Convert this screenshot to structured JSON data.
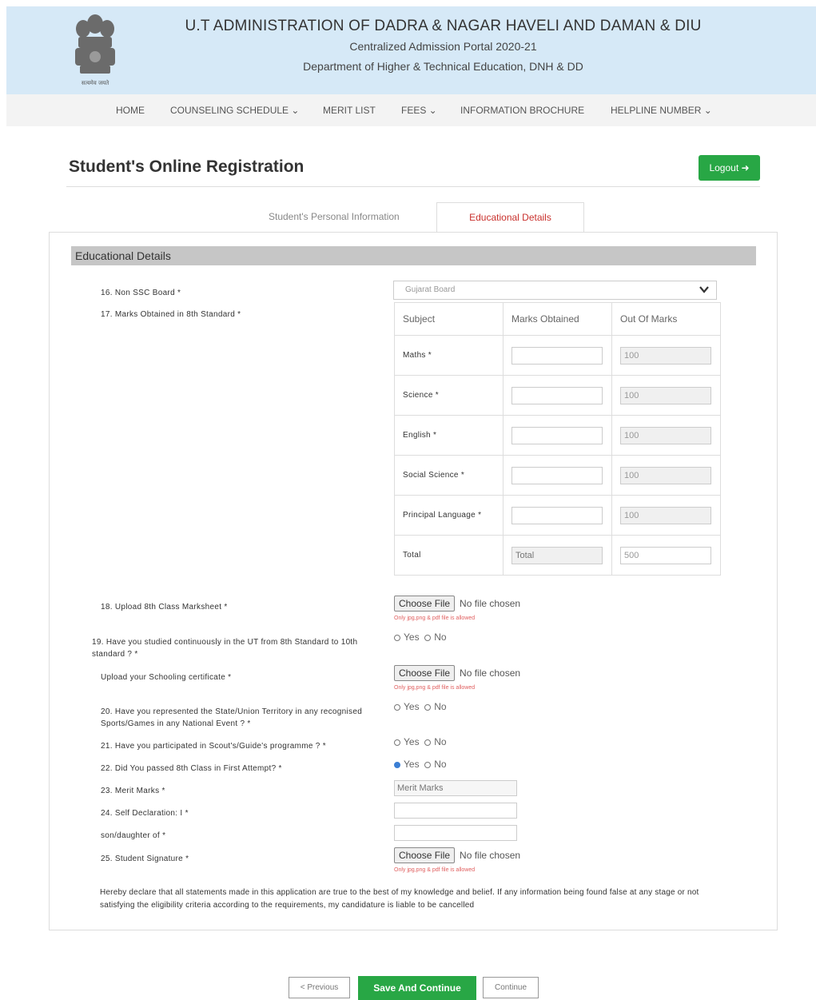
{
  "header": {
    "title": "U.T ADMINISTRATION OF DADRA & NAGAR HAVELI AND DAMAN & DIU",
    "subtitle1": "Centralized Admission Portal 2020-21",
    "subtitle2": "Department of Higher & Technical Education, DNH & DD",
    "emblem_caption": "सत्यमेव जयते"
  },
  "nav": {
    "items": [
      {
        "label": "HOME"
      },
      {
        "label": "COUNSELING SCHEDULE ⌄"
      },
      {
        "label": "MERIT LIST"
      },
      {
        "label": "FEES ⌄"
      },
      {
        "label": "INFORMATION BROCHURE"
      },
      {
        "label": "HELPLINE NUMBER ⌄"
      }
    ]
  },
  "page": {
    "title": "Student's Online Registration",
    "logout_label": "Logout ➜"
  },
  "tabs": {
    "personal": "Student's Personal Information",
    "educational": "Educational Details"
  },
  "section": {
    "title": "Educational Details"
  },
  "form": {
    "q16": "16. Non SSC Board *",
    "board_selected": "Gujarat Board",
    "q17": "17. Marks Obtained in 8th Standard *",
    "table": {
      "headers": [
        "Subject",
        "Marks Obtained",
        "Out Of Marks"
      ],
      "rows": [
        {
          "subject": "Maths *",
          "obtained": "",
          "out_of": "100"
        },
        {
          "subject": "Science *",
          "obtained": "",
          "out_of": "100"
        },
        {
          "subject": "English *",
          "obtained": "",
          "out_of": "100"
        },
        {
          "subject": "Social Science *",
          "obtained": "",
          "out_of": "100"
        },
        {
          "subject": "Principal Language *",
          "obtained": "",
          "out_of": "100"
        }
      ],
      "total_label": "Total",
      "total_placeholder": "Total",
      "total_out_of": "500"
    },
    "q18": "18. Upload 8th Class Marksheet *",
    "file_button": "Choose File",
    "no_file": "No file chosen",
    "file_note": "Only jpg,png & pdf file is allowed",
    "q19": "19. Have you studied continuously in the UT from 8th Standard to 10th standard ? *",
    "schooling_cert": "Upload your Schooling certificate *",
    "q20": "20. Have you represented the State/Union Territory in any recognised Sports/Games in any National Event ? *",
    "q21": "21. Have you participated in Scout's/Guide's programme ? *",
    "q22": "22. Did You passed 8th Class in First Attempt? *",
    "q23": "23. Merit Marks *",
    "merit_placeholder": "Merit Marks",
    "q24": "24. Self Declaration: I *",
    "son_daughter": "son/daughter of *",
    "q25": "25. Student Signature *",
    "yes": "Yes",
    "no": "No",
    "declaration": "Hereby declare that all statements made in this application are true to the best of my knowledge and belief. If any information being found false at any stage or not satisfying the eligibility criteria according to the requirements, my candidature is liable to be cancelled"
  },
  "buttons": {
    "previous": "< Previous",
    "save": "Save And Continue",
    "continue": "Continue"
  },
  "colors": {
    "header_bg": "#d6e9f7",
    "accent_green": "#28a745",
    "active_tab": "#c9302c"
  }
}
